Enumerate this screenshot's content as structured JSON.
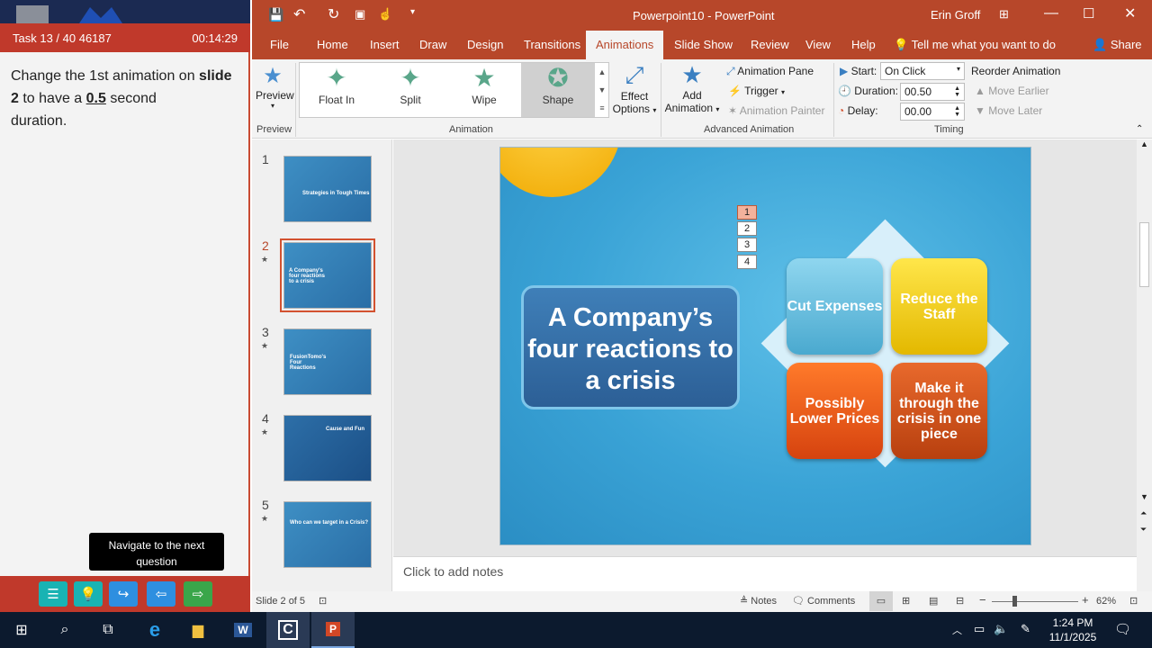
{
  "task": {
    "header_left": "Task 13 / 40 46187",
    "timer": "00:14:29",
    "text_1": "Change the 1st animation on",
    "text_slide": "slide 2",
    "text_2": "to have a",
    "text_value": "0.5",
    "text_3": "second",
    "text_4": "duration.",
    "tooltip": "Navigate to the next question"
  },
  "title": {
    "doc": "Powerpoint10  -  PowerPoint",
    "user": "Erin Groff"
  },
  "tabs": [
    "File",
    "Home",
    "Insert",
    "Draw",
    "Design",
    "Transitions",
    "Animations",
    "Slide Show",
    "Review",
    "View",
    "Help"
  ],
  "tell_me": "Tell me what you want to do",
  "share": "Share",
  "ribbon": {
    "preview": "Preview",
    "preview_group": "Preview",
    "animations": [
      "Float In",
      "Split",
      "Wipe",
      "Shape"
    ],
    "effect_options_1": "Effect",
    "effect_options_2": "Options",
    "animation_group": "Animation",
    "add_animation_1": "Add",
    "add_animation_2": "Animation",
    "animation_pane": "Animation Pane",
    "trigger": "Trigger",
    "animation_painter": "Animation Painter",
    "advanced_group": "Advanced Animation",
    "start_label": "Start:",
    "start_value": "On Click",
    "duration_label": "Duration:",
    "duration_value": "00.50",
    "delay_label": "Delay:",
    "delay_value": "00.00",
    "reorder": "Reorder Animation",
    "move_earlier": "Move Earlier",
    "move_later": "Move Later",
    "timing_group": "Timing"
  },
  "thumbs": [
    {
      "num": "1",
      "title": "Strategies in Tough Times"
    },
    {
      "num": "2",
      "title": "A Company's four reactions to a crisis"
    },
    {
      "num": "3",
      "title": "FusionTomo's Four Reactions"
    },
    {
      "num": "4",
      "title": "Cause and Fun"
    },
    {
      "num": "5",
      "title": "Who can we target in a Crisis?"
    }
  ],
  "slide": {
    "title": "A Company’s four reactions to a crisis",
    "quads": [
      "Cut Expenses",
      "Reduce the Staff",
      "Possibly Lower Prices",
      "Make it through the crisis in one piece"
    ],
    "anim_numbers": [
      "1",
      "2",
      "3",
      "4"
    ]
  },
  "notes_placeholder": "Click to add notes",
  "status": {
    "slide": "Slide 2 of 5",
    "notes": "Notes",
    "comments": "Comments",
    "zoom": "62%"
  },
  "clock": {
    "time": "1:24 PM",
    "date": "11/1/2025"
  },
  "colors": {
    "accent": "#b7472a",
    "task_red": "#c0392b"
  }
}
